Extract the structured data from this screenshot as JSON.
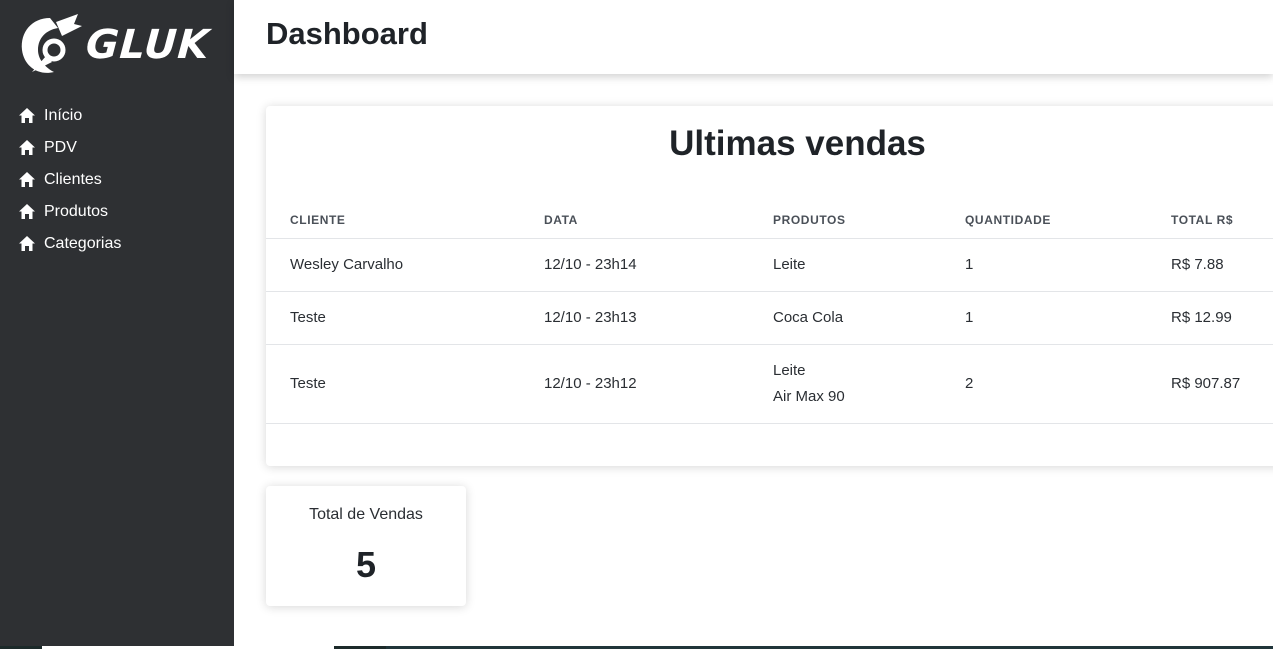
{
  "brand": {
    "name": "GLUK"
  },
  "sidebar": {
    "items": [
      {
        "label": "Início",
        "icon": "home-icon"
      },
      {
        "label": "PDV",
        "icon": "home-icon"
      },
      {
        "label": "Clientes",
        "icon": "home-icon"
      },
      {
        "label": "Produtos",
        "icon": "home-icon"
      },
      {
        "label": "Categorias",
        "icon": "home-icon"
      }
    ]
  },
  "header": {
    "title": "Dashboard"
  },
  "sales": {
    "title": "Ultimas vendas",
    "columns": [
      "CLIENTE",
      "DATA",
      "PRODUTOS",
      "QUANTIDADE",
      "TOTAL R$"
    ],
    "rows": [
      {
        "cliente": "Wesley Carvalho",
        "data": "12/10 - 23h14",
        "produtos": [
          "Leite"
        ],
        "quantidade": "1",
        "total": "R$ 7.88"
      },
      {
        "cliente": "Teste",
        "data": "12/10 - 23h13",
        "produtos": [
          "Coca Cola"
        ],
        "quantidade": "1",
        "total": "R$ 12.99"
      },
      {
        "cliente": "Teste",
        "data": "12/10 - 23h12",
        "produtos": [
          "Leite",
          "Air Max 90"
        ],
        "quantidade": "2",
        "total": "R$ 907.87"
      }
    ]
  },
  "summary": {
    "label": "Total de Vendas",
    "value": "5"
  },
  "colors": {
    "sidebar_bg": "#2e3033",
    "text_dark": "#1f2328",
    "white": "#ffffff"
  }
}
